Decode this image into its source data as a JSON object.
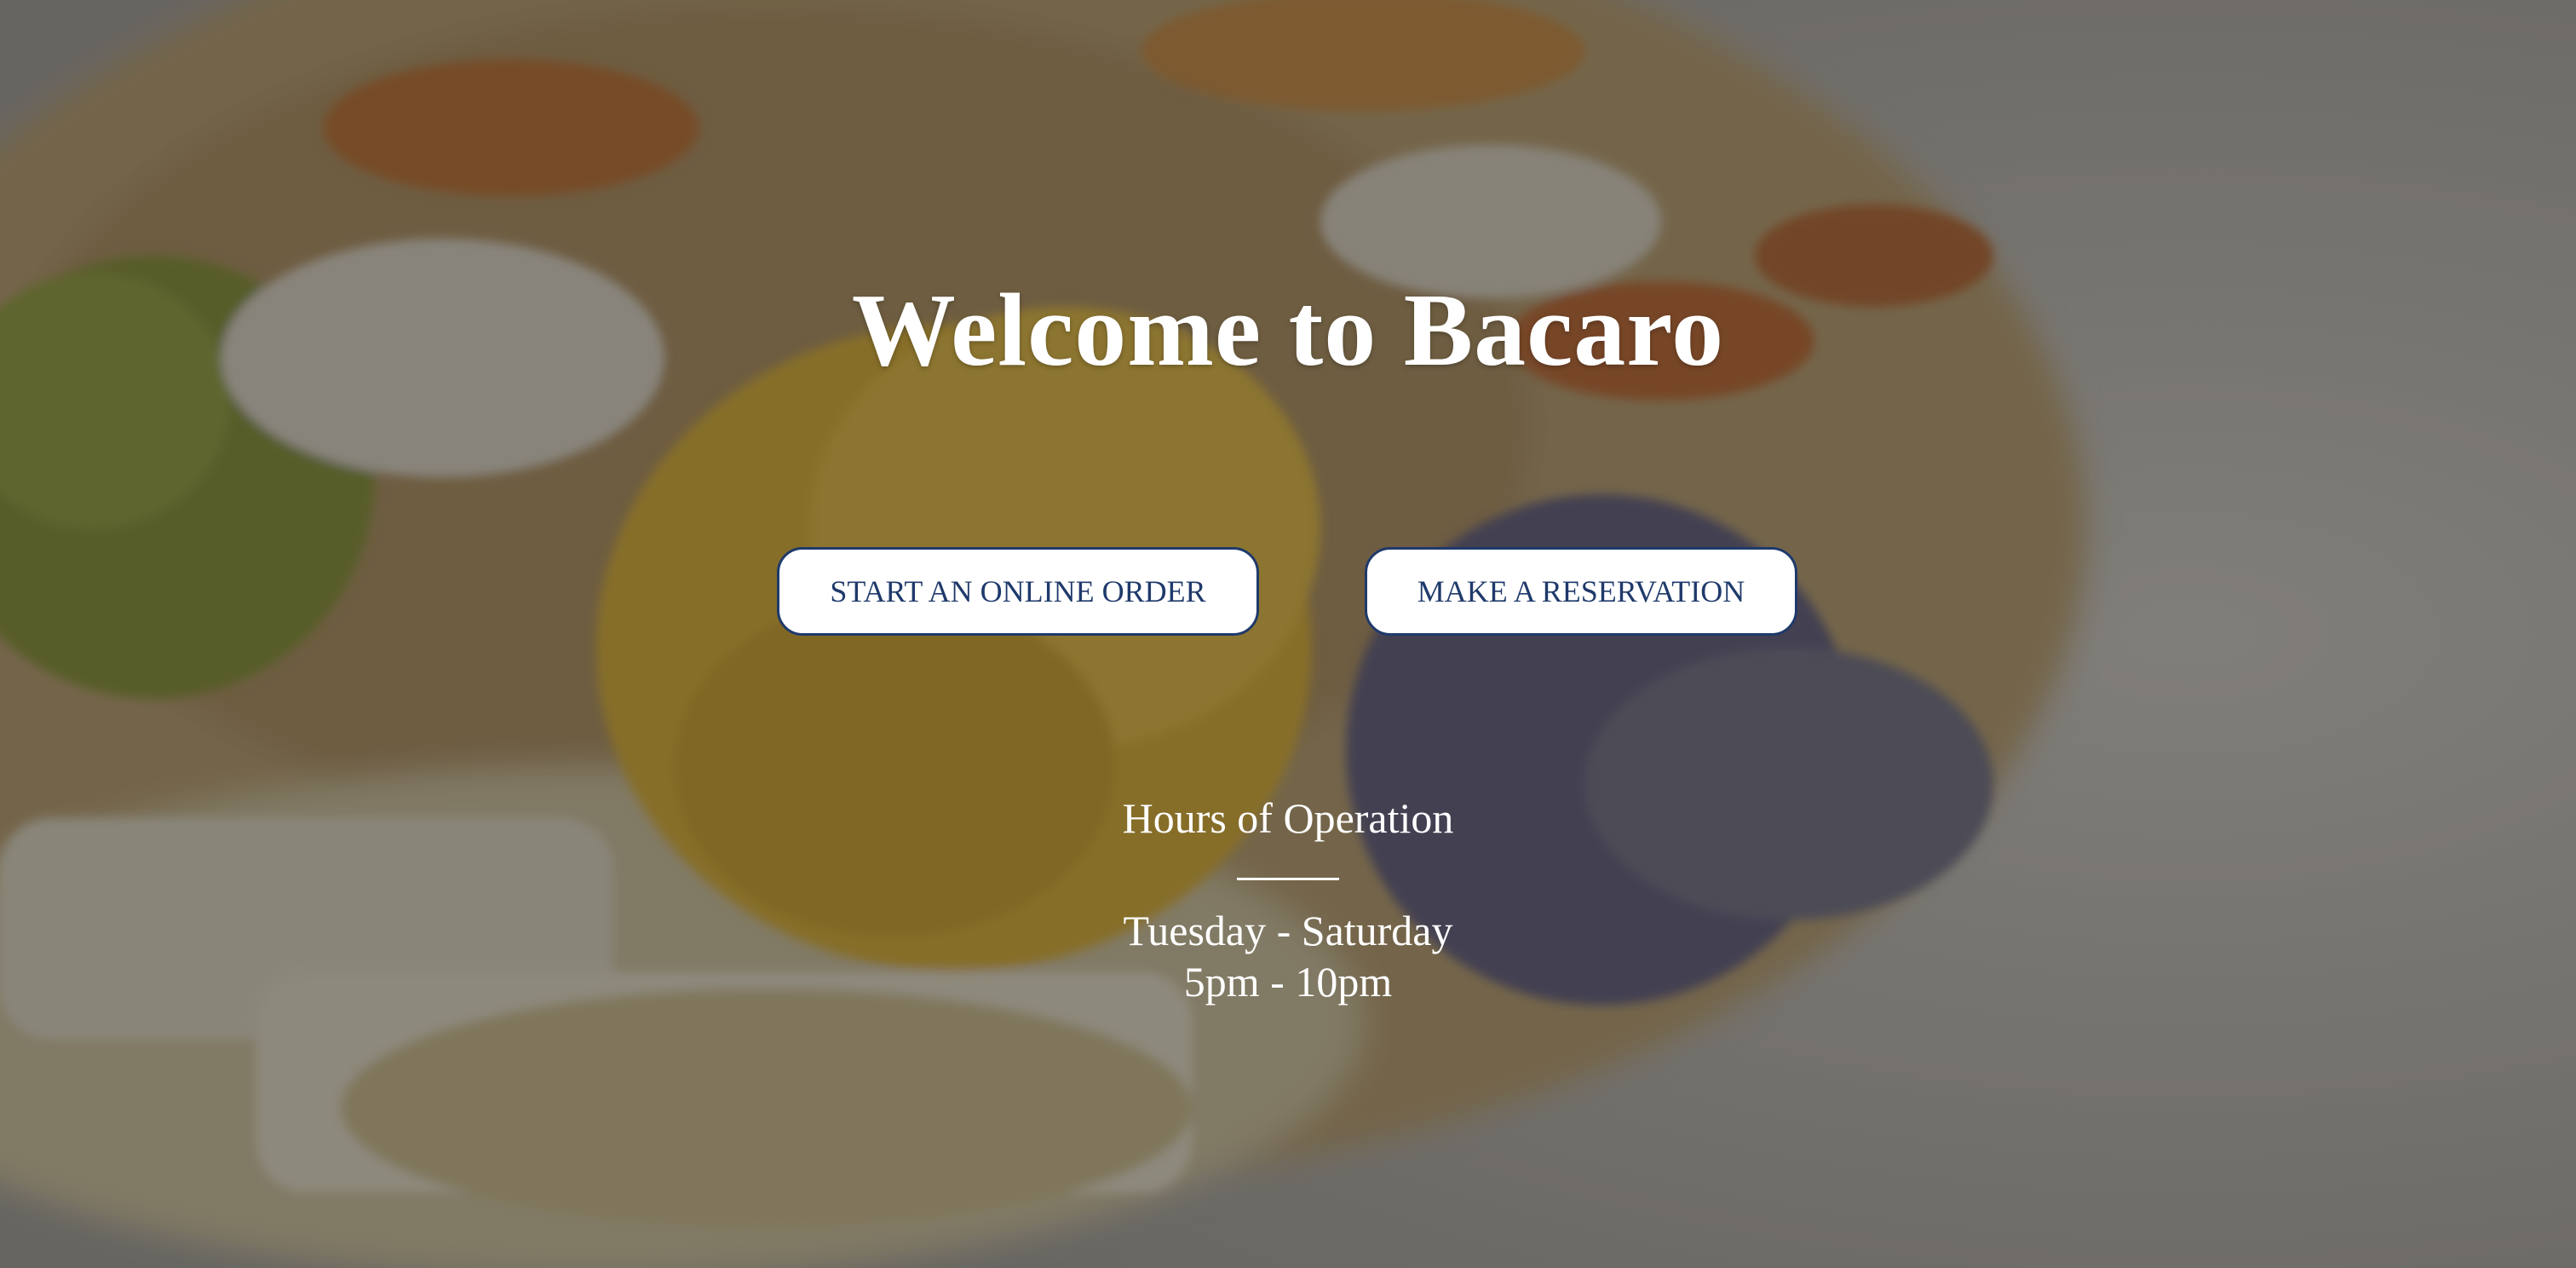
{
  "hero": {
    "title": "Welcome to Bacaro",
    "background_image": "pasta-dish-photo"
  },
  "actions": {
    "order_label": "START AN ONLINE ORDER",
    "reservation_label": "MAKE A RESERVATION"
  },
  "hours": {
    "heading": "Hours of Operation",
    "days": "Tuesday - Saturday",
    "time": "5pm - 10pm"
  },
  "colors": {
    "button_text": "#1f3a6b",
    "button_border": "#1f3a6b",
    "button_bg": "#ffffff",
    "heading_text": "#ffffff"
  }
}
